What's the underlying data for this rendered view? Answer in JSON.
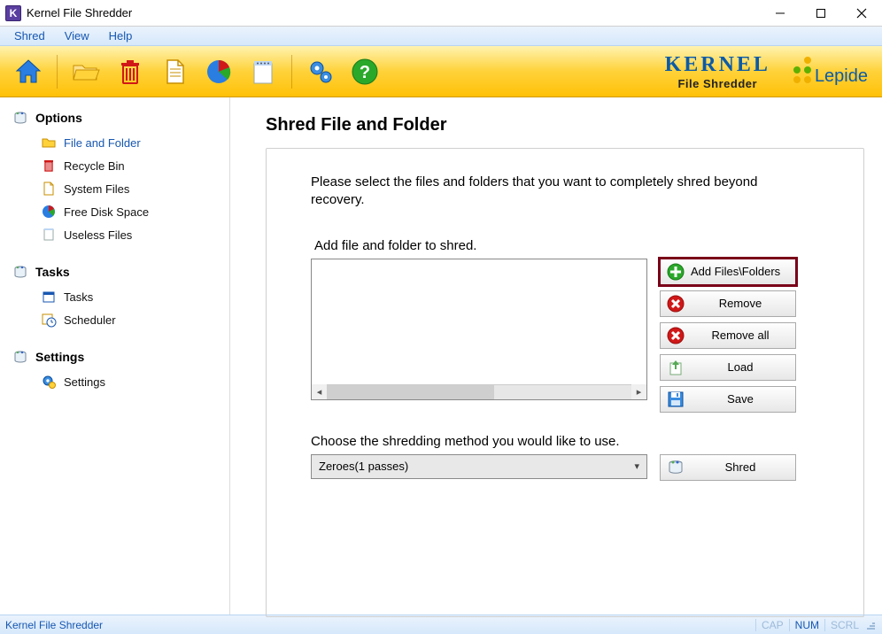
{
  "window": {
    "title": "Kernel File Shredder"
  },
  "menus": {
    "shred": "Shred",
    "view": "View",
    "help": "Help"
  },
  "brand": {
    "line1": "KERNEL",
    "line2": "File Shredder",
    "company": "Lepide"
  },
  "sidebar": {
    "groups": [
      {
        "title": "Options",
        "items": [
          {
            "label": "File and Folder",
            "icon": "folder-icon",
            "active": true
          },
          {
            "label": "Recycle Bin",
            "icon": "trash-red-icon"
          },
          {
            "label": "System Files",
            "icon": "document-icon"
          },
          {
            "label": "Free Disk Space",
            "icon": "piechart-icon"
          },
          {
            "label": "Useless Files",
            "icon": "page-icon"
          }
        ]
      },
      {
        "title": "Tasks",
        "items": [
          {
            "label": "Tasks",
            "icon": "calendar-icon"
          },
          {
            "label": "Scheduler",
            "icon": "clock-icon"
          }
        ]
      },
      {
        "title": "Settings",
        "items": [
          {
            "label": "Settings",
            "icon": "gear-small-icon"
          }
        ]
      }
    ]
  },
  "main": {
    "heading": "Shred File and Folder",
    "intro": "Please select the files and folders that you want to completely shred beyond recovery.",
    "add_label": "Add file and folder to shred.",
    "method_label": "Choose the shredding method you would like to use.",
    "method_selected": "Zeroes(1 passes)",
    "buttons": {
      "add": "Add Files\\Folders",
      "remove": "Remove",
      "removeall": "Remove all",
      "load": "Load",
      "save": "Save",
      "shred": "Shred"
    }
  },
  "status": {
    "left": "Kernel File Shredder",
    "cap": "CAP",
    "num": "NUM",
    "scrl": "SCRL"
  }
}
